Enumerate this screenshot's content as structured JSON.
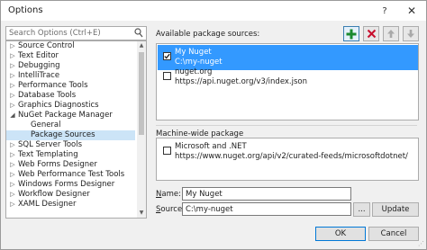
{
  "window": {
    "title": "Options",
    "help_label": "?",
    "close_label": "✕"
  },
  "search": {
    "placeholder": "Search Options (Ctrl+E)"
  },
  "tree": {
    "items": [
      {
        "label": "Source Control",
        "arrow": "▷"
      },
      {
        "label": "Text Editor",
        "arrow": "▷"
      },
      {
        "label": "Debugging",
        "arrow": "▷"
      },
      {
        "label": "IntelliTrace",
        "arrow": "▷"
      },
      {
        "label": "Performance Tools",
        "arrow": "▷"
      },
      {
        "label": "Database Tools",
        "arrow": "▷"
      },
      {
        "label": "Graphics Diagnostics",
        "arrow": "▷"
      },
      {
        "label": "NuGet Package Manager",
        "arrow": "◢"
      },
      {
        "label": "General",
        "arrow": ""
      },
      {
        "label": "Package Sources",
        "arrow": ""
      },
      {
        "label": "SQL Server Tools",
        "arrow": "▷"
      },
      {
        "label": "Text Templating",
        "arrow": "▷"
      },
      {
        "label": "Web Forms Designer",
        "arrow": "▷"
      },
      {
        "label": "Web Performance Test Tools",
        "arrow": "▷"
      },
      {
        "label": "Windows Forms Designer",
        "arrow": "▷"
      },
      {
        "label": "Workflow Designer",
        "arrow": "▷"
      },
      {
        "label": "XAML Designer",
        "arrow": "▷"
      }
    ],
    "selected": "Package Sources"
  },
  "available": {
    "heading": "Available package sources:",
    "sources": [
      {
        "name": "My Nuget",
        "url": "C:\\my-nuget",
        "checked": true
      },
      {
        "name": "nuget.org",
        "url": "https://api.nuget.org/v3/index.json",
        "checked": false
      }
    ]
  },
  "machine_wide": {
    "heading": "Machine-wide package",
    "sources": [
      {
        "name": "Microsoft and .NET",
        "url": "https://www.nuget.org/api/v2/curated-feeds/microsoftdotnet/",
        "checked": false
      }
    ]
  },
  "form": {
    "name_label_prefix": "N",
    "name_label_rest": "ame:",
    "name_value": "My Nuget",
    "source_label_prefix": "S",
    "source_label_rest": "ource:",
    "source_value": "C:\\my-nuget",
    "browse_label": "...",
    "update_label": "Update"
  },
  "footer": {
    "ok_label": "OK",
    "cancel_label": "Cancel"
  },
  "colors": {
    "selection": "#3399ff",
    "tree_selection": "#cce4f7",
    "add_icon": "#1b8a2f",
    "remove_icon": "#c8102e"
  },
  "icons": [
    "search-icon",
    "add-icon",
    "remove-icon",
    "arrow-up-icon",
    "arrow-down-icon",
    "checkbox-checked-icon",
    "expand-arrow-icon",
    "collapse-arrow-icon",
    "close-icon",
    "help-icon",
    "resize-grip-icon"
  ]
}
